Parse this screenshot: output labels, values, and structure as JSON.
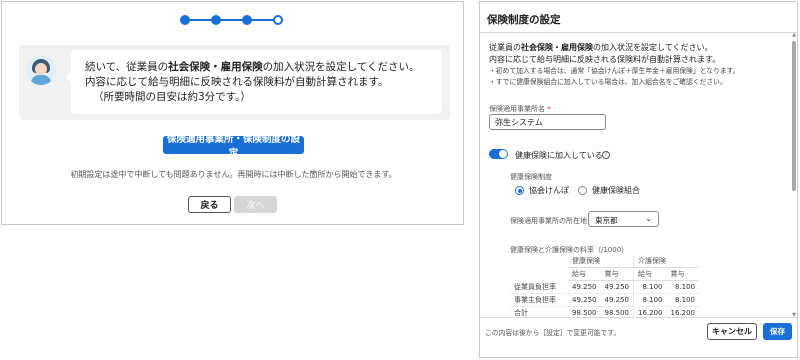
{
  "wizard": {
    "steps": [
      {
        "state": "done"
      },
      {
        "state": "done"
      },
      {
        "state": "done"
      },
      {
        "state": "pending"
      }
    ],
    "message": {
      "line1_pre": "続いて、従業員の",
      "line1_bold": "社会保険・雇用保険",
      "line1_post": "の加入状況を設定してください。",
      "line2": "内容に応じて給与明細に反映される保険料が自動計算されます。",
      "line3": "（所要時間の目安は約3分です。）"
    },
    "primary_button": "保険適用事業所・保険制度の設定",
    "hint": "初期設定は途中で中断しても問題ありません。再開時には中断した箇所から開始できます。",
    "back_button": "戻る",
    "next_button": "次へ"
  },
  "dialog": {
    "title": "保険制度の設定",
    "intro": {
      "line1_pre": "従業員の",
      "line1_bold": "社会保険・雇用保険",
      "line1_post": "の加入状況を設定してください。",
      "line2": "内容に応じて給与明細に反映される保険料が自動計算されます。",
      "note1": "・初めて加入する場合は、通常「協会けんぽ＋厚生年金＋雇用保険」となります。",
      "note2": "・すでに健康保険組合に加入している場合は、加入組合名をご確認ください。"
    },
    "office_name": {
      "label": "保険適用事業所名",
      "required_mark": "*",
      "value": "弥生システム"
    },
    "health_insurance": {
      "toggle_label": "健康保険に加入している",
      "help_icon": "?",
      "enabled": true,
      "system_label": "健康保険制度",
      "options": [
        "協会けんぽ",
        "健康保険組合"
      ],
      "selected_option": "協会けんぽ",
      "location_label": "保険適用事業所の所在地",
      "location_value": "東京都"
    },
    "rates_table": {
      "title": "健康保険と介護保険の料率（/1000）",
      "groups": [
        "健康保険",
        "介護保険"
      ],
      "subheaders": [
        "給与",
        "賞与",
        "給与",
        "賞与"
      ],
      "rows": [
        {
          "label": "従業員負担率",
          "values": [
            "49.250",
            "49.250",
            "8.100",
            "8.100"
          ]
        },
        {
          "label": "事業主負担率",
          "values": [
            "49.250",
            "49.250",
            "8.100",
            "8.100"
          ]
        },
        {
          "label": "合計",
          "values": [
            "98.500",
            "98.500",
            "16.200",
            "16.200"
          ]
        }
      ]
    },
    "footer": {
      "note": "この内容は後から［設定］で変更可能です。",
      "cancel": "キャンセル",
      "save": "保存"
    }
  },
  "colors": {
    "accent": "#1a6fd6",
    "disabled": "#d6d6d6"
  }
}
